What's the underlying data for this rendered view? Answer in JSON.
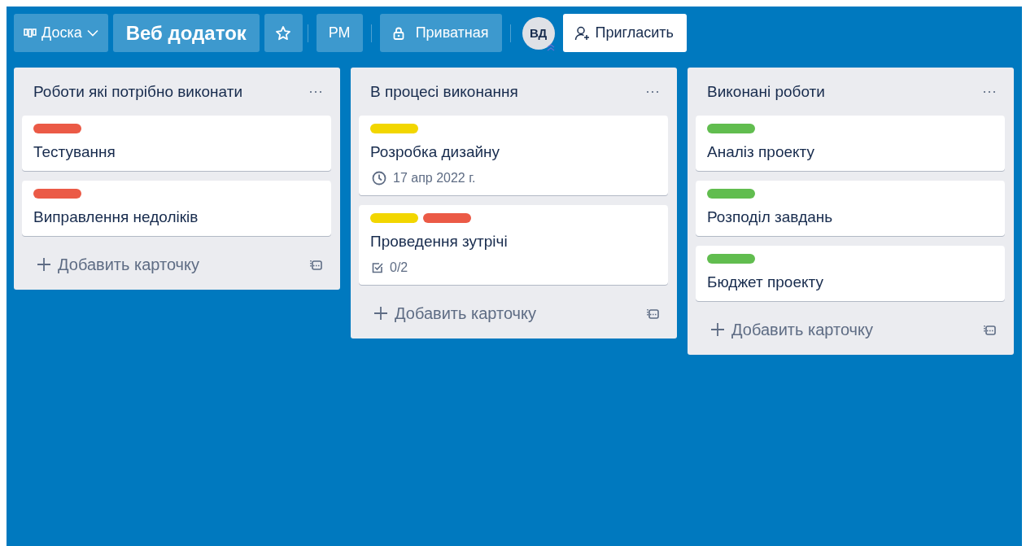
{
  "header": {
    "board_switcher": "Доска",
    "board_title": "Веб додаток",
    "workspace": "РМ",
    "visibility": "Приватная",
    "member_initials": "ВД",
    "invite": "Пригласить"
  },
  "lists": [
    {
      "title": "Роботи які потрібно виконати",
      "menu": "···",
      "add_card": "Добавить карточку",
      "cards": [
        {
          "labels": [
            {
              "color": "#eb5a46"
            }
          ],
          "title": "Тестування"
        },
        {
          "labels": [
            {
              "color": "#eb5a46"
            }
          ],
          "title": "Виправлення недоліків"
        }
      ]
    },
    {
      "title": "В процесі виконання",
      "menu": "···",
      "add_card": "Добавить карточку",
      "cards": [
        {
          "labels": [
            {
              "color": "#f2d600"
            }
          ],
          "title": "Розробка дизайну",
          "badge": {
            "kind": "date",
            "text": "17 апр 2022 г."
          }
        },
        {
          "labels": [
            {
              "color": "#f2d600"
            },
            {
              "color": "#eb5a46"
            }
          ],
          "title": "Проведення зутрічі",
          "badge": {
            "kind": "checklist",
            "text": "0/2"
          }
        }
      ]
    },
    {
      "title": "Виконані роботи",
      "menu": "···",
      "add_card": "Добавить карточку",
      "cards": [
        {
          "labels": [
            {
              "color": "#61bd4f"
            }
          ],
          "title": "Аналіз проекту"
        },
        {
          "labels": [
            {
              "color": "#61bd4f"
            }
          ],
          "title": "Розподіл завдань"
        },
        {
          "labels": [
            {
              "color": "#61bd4f"
            }
          ],
          "title": "Бюджет проекту"
        }
      ]
    }
  ]
}
